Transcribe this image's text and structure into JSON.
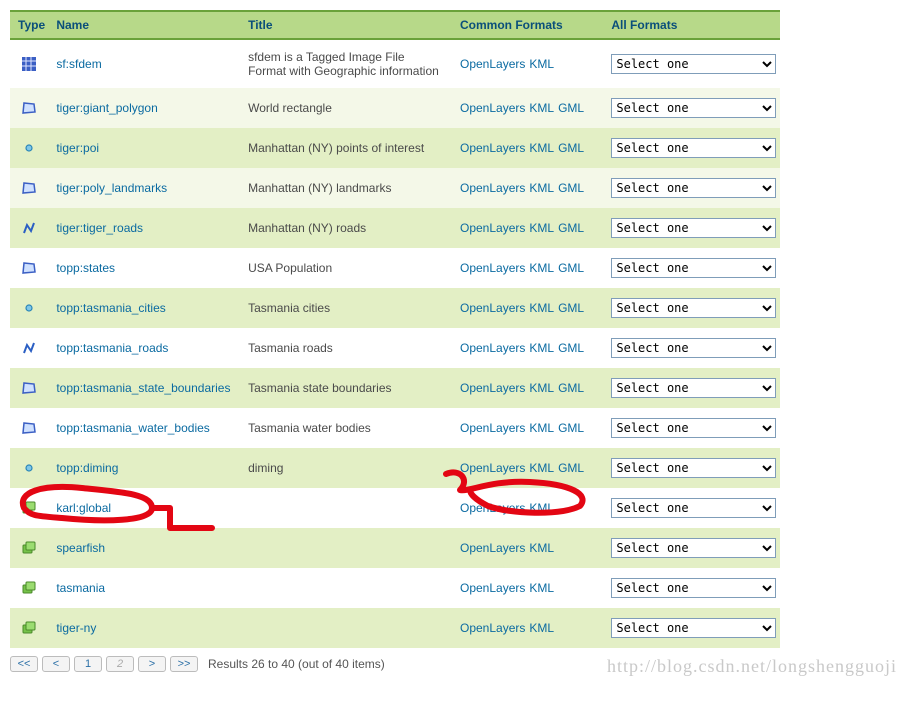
{
  "headers": {
    "type": "Type",
    "name": "Name",
    "title": "Title",
    "common": "Common Formats",
    "all": "All Formats"
  },
  "rows": [
    {
      "icon": "raster-hash",
      "name": "sf:sfdem",
      "title": "sfdem is a Tagged Image File Format with Geographic information",
      "formats": [
        "OpenLayers",
        "KML"
      ],
      "rowclass": "even"
    },
    {
      "icon": "poly-blue",
      "name": "tiger:giant_polygon",
      "title": "World rectangle",
      "formats": [
        "OpenLayers",
        "KML",
        "GML"
      ],
      "rowclass": "odd"
    },
    {
      "icon": "point",
      "name": "tiger:poi",
      "title": "Manhattan (NY) points of interest",
      "formats": [
        "OpenLayers",
        "KML",
        "GML"
      ],
      "rowclass": "odd2"
    },
    {
      "icon": "poly-blue",
      "name": "tiger:poly_landmarks",
      "title": "Manhattan (NY) landmarks",
      "formats": [
        "OpenLayers",
        "KML",
        "GML"
      ],
      "rowclass": "odd"
    },
    {
      "icon": "line",
      "name": "tiger:tiger_roads",
      "title": "Manhattan (NY) roads",
      "formats": [
        "OpenLayers",
        "KML",
        "GML"
      ],
      "rowclass": "odd2"
    },
    {
      "icon": "poly-blue",
      "name": "topp:states",
      "title": "USA Population",
      "formats": [
        "OpenLayers",
        "KML",
        "GML"
      ],
      "rowclass": "even"
    },
    {
      "icon": "point",
      "name": "topp:tasmania_cities",
      "title": "Tasmania cities",
      "formats": [
        "OpenLayers",
        "KML",
        "GML"
      ],
      "rowclass": "odd2"
    },
    {
      "icon": "line",
      "name": "topp:tasmania_roads",
      "title": "Tasmania roads",
      "formats": [
        "OpenLayers",
        "KML",
        "GML"
      ],
      "rowclass": "even"
    },
    {
      "icon": "poly-blue",
      "name": "topp:tasmania_state_boundaries",
      "title": "Tasmania state boundaries",
      "formats": [
        "OpenLayers",
        "KML",
        "GML"
      ],
      "rowclass": "odd2"
    },
    {
      "icon": "poly-blue",
      "name": "topp:tasmania_water_bodies",
      "title": "Tasmania water bodies",
      "formats": [
        "OpenLayers",
        "KML",
        "GML"
      ],
      "rowclass": "even"
    },
    {
      "icon": "point",
      "name": "topp:diming",
      "title": "diming",
      "formats": [
        "OpenLayers",
        "KML",
        "GML"
      ],
      "rowclass": "odd2"
    },
    {
      "icon": "group-green",
      "name": "karl:global",
      "title": "",
      "formats": [
        "OpenLayers",
        "KML"
      ],
      "rowclass": "even"
    },
    {
      "icon": "group-green",
      "name": "spearfish",
      "title": "",
      "formats": [
        "OpenLayers",
        "KML"
      ],
      "rowclass": "odd2"
    },
    {
      "icon": "group-green",
      "name": "tasmania",
      "title": "",
      "formats": [
        "OpenLayers",
        "KML"
      ],
      "rowclass": "even"
    },
    {
      "icon": "group-green",
      "name": "tiger-ny",
      "title": "",
      "formats": [
        "OpenLayers",
        "KML"
      ],
      "rowclass": "odd2"
    }
  ],
  "select_placeholder": "Select one",
  "pager": {
    "first": "<<",
    "prev": "<",
    "page1": "1",
    "page2": "2",
    "next": ">",
    "last": ">>",
    "info": "Results 26 to 40 (out of 40 items)"
  },
  "watermark": "http://blog.csdn.net/longshengguoji"
}
